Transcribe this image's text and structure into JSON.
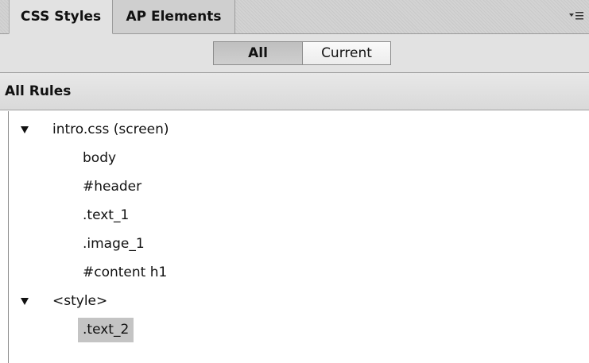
{
  "tabs": [
    {
      "label": "CSS Styles",
      "active": true
    },
    {
      "label": "AP Elements",
      "active": false
    }
  ],
  "toggle": {
    "all_label": "All",
    "current_label": "Current",
    "selected": "All"
  },
  "section_header": "All Rules",
  "tree": {
    "groups": [
      {
        "label": "intro.css (screen)",
        "expanded": true,
        "rules": [
          "body",
          "#header",
          ".text_1",
          ".image_1",
          "#content h1"
        ]
      },
      {
        "label": "<style>",
        "expanded": true,
        "rules": [
          ".text_2"
        ]
      }
    ],
    "selected_rule": ".text_2"
  },
  "icons": {
    "panel_menu": "panel-menu-icon",
    "expand": "triangle-down-icon"
  }
}
